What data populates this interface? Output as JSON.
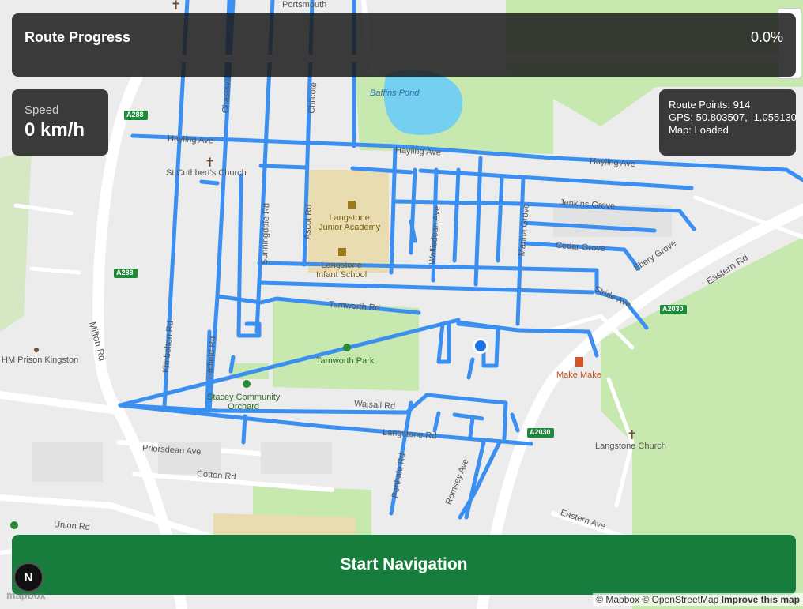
{
  "progress": {
    "title": "Route Progress",
    "percent_label": "0.0%",
    "fraction": 0.0
  },
  "speed": {
    "label": "Speed",
    "value": "0 km/h"
  },
  "info": {
    "route_points": "Route Points: 914",
    "gps": "GPS: 50.803507, -1.055130",
    "map_status": "Map: Loaded"
  },
  "start_button": "Start Navigation",
  "nav_badge": "N",
  "attribution": {
    "mapbox": "© Mapbox",
    "osm": "© OpenStreetMap",
    "improve": "Improve this map"
  },
  "mapbox_logo": "mapbox",
  "colors": {
    "route": "#3b8ff0",
    "panel_bg": "#1c1c1c",
    "button": "#167d3c",
    "park": "#c7e9b0",
    "water": "#75cff0",
    "location": "#1a73e8"
  },
  "map_labels": {
    "portsmouth": "Portsmouth",
    "baffins_pond": "Baffins Pond",
    "hayling_ave_1": "Hayling Ave",
    "hayling_ave_2": "Hayling Ave",
    "hayling_ave_3": "Hayling Ave",
    "st_cuthberts": "St Cuthbert's Church",
    "langstone_junior": "Langstone",
    "langstone_junior_2": "Junior Academy",
    "langstone_infant": "Langstone",
    "langstone_infant_2": "Infant School",
    "jenkins_grove": "Jenkins Grove",
    "cedar_grove": "Cedar Grove",
    "ebery_grove": "Ebery Grove",
    "eastern_rd": "Eastern Rd",
    "stride_ave": "Stride Ave",
    "tamworth_rd": "Tamworth Rd",
    "tamworth_park": "Tamworth Park",
    "make_make": "Make Make",
    "milton_rd": "Milton Rd",
    "hm_prison": "HM Prison Kingston",
    "kimbolton_rd": "Kimbolton Rd",
    "hatfield_rd": "Hatfield Rd",
    "stacey_orchard": "Stacey Community",
    "stacey_orchard_2": "Orchard",
    "walsall_rd": "Walsall Rd",
    "langstone_rd": "Langstone Rd",
    "langstone_church": "Langstone Church",
    "priorsdean_ave": "Priorsdean Ave",
    "cotton_rd": "Cotton Rd",
    "union_rd": "Union Rd",
    "eastern_ave": "Eastern Ave",
    "romsey_ave": "Romsey Ave",
    "penhale_rd": "Penhale Rd",
    "sunningdale_rd": "Sunningdale Rd",
    "ascot_rd": "Ascot Rd",
    "wallisdean_ave": "Wallisdean Ave",
    "marina_grove": "Marina Grove",
    "chasewater": "Chasewater",
    "chilcote": "Chilcote",
    "a288_1": "A288",
    "a288_2": "A288",
    "a2030_1": "A2030",
    "a2030_2": "A2030"
  }
}
